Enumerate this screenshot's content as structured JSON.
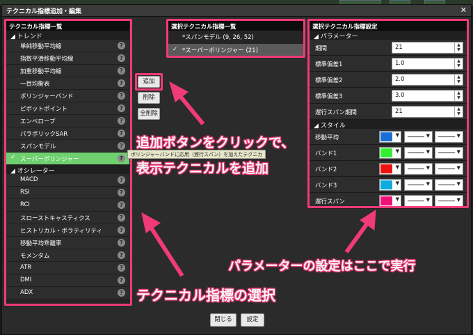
{
  "window": {
    "title": "テクニカル指標追加・編集",
    "close_glyph": "✕"
  },
  "indicator_list": {
    "header": "テクニカル指標一覧",
    "groups": [
      {
        "label": "トレンド",
        "items": [
          {
            "label": "単純移動平均線",
            "selected": false
          },
          {
            "label": "指数平滑移動平均線",
            "selected": false
          },
          {
            "label": "加重移動平均線",
            "selected": false
          },
          {
            "label": "一目均衡表",
            "selected": false
          },
          {
            "label": "ボリンジャーバンド",
            "selected": false
          },
          {
            "label": "ピボットポイント",
            "selected": false
          },
          {
            "label": "エンベロープ",
            "selected": false
          },
          {
            "label": "パラボリックSAR",
            "selected": false
          },
          {
            "label": "スパンモデル",
            "selected": false
          },
          {
            "label": "スーパーボリンジャー",
            "selected": true
          }
        ]
      },
      {
        "label": "オシレーター",
        "items": [
          {
            "label": "MACD",
            "selected": false
          },
          {
            "label": "RSI",
            "selected": false
          },
          {
            "label": "RCI",
            "selected": false
          },
          {
            "label": "スローストキャスティクス",
            "selected": false
          },
          {
            "label": "ヒストリカル・ボラティリティ",
            "selected": false
          },
          {
            "label": "移動平均乖離率",
            "selected": false
          },
          {
            "label": "モメンタム",
            "selected": false
          },
          {
            "label": "ATR",
            "selected": false
          },
          {
            "label": "DMI",
            "selected": false
          },
          {
            "label": "ADX",
            "selected": false
          }
        ]
      }
    ],
    "help_glyph": "?",
    "check_glyph": "✓"
  },
  "tooltip": "ボリンジャーバンドに応用（遅行スパン）を加えたテクニカ",
  "middle_buttons": {
    "add": "追加",
    "delete": "削除",
    "delete_all": "全削除"
  },
  "selected_list": {
    "header": "選択テクニカル指標一覧",
    "items": [
      {
        "label": "*スパンモデル (9, 26, 52)",
        "active": false
      },
      {
        "label": "*スーパーボリンジャー (21)",
        "active": true
      }
    ]
  },
  "settings": {
    "header": "選択テクニカル指標設定",
    "params_group": "パラメーター",
    "params": [
      {
        "label": "期間",
        "value": "21"
      },
      {
        "label": "標準偏差1",
        "value": "1.0"
      },
      {
        "label": "標準偏差2",
        "value": "2.0"
      },
      {
        "label": "標準偏差3",
        "value": "3.0"
      },
      {
        "label": "遅行スパン期間",
        "value": "21"
      }
    ],
    "style_group": "スタイル",
    "styles": [
      {
        "label": "移動平均",
        "color": "#1a6fd6"
      },
      {
        "label": "バンド1",
        "color": "#33ee33"
      },
      {
        "label": "バンド2",
        "color": "#ee1111"
      },
      {
        "label": "バンド3",
        "color": "#11aadd"
      },
      {
        "label": "遅行スパン",
        "color": "#ee1177"
      }
    ],
    "spin_glyph": "▲▼",
    "dropdown_glyph": "▼"
  },
  "footer": {
    "close": "閉じる",
    "apply": "設定"
  },
  "annotations": {
    "add_line1": "追加ボタンをクリックで、",
    "add_line2": "表示テクニカルを追加",
    "params": "パラメーターの設定はここで実行",
    "select": "テクニカル指標の選択"
  },
  "colors": {
    "highlight": "#f03a7a",
    "selected_row": "#6fd06f"
  }
}
